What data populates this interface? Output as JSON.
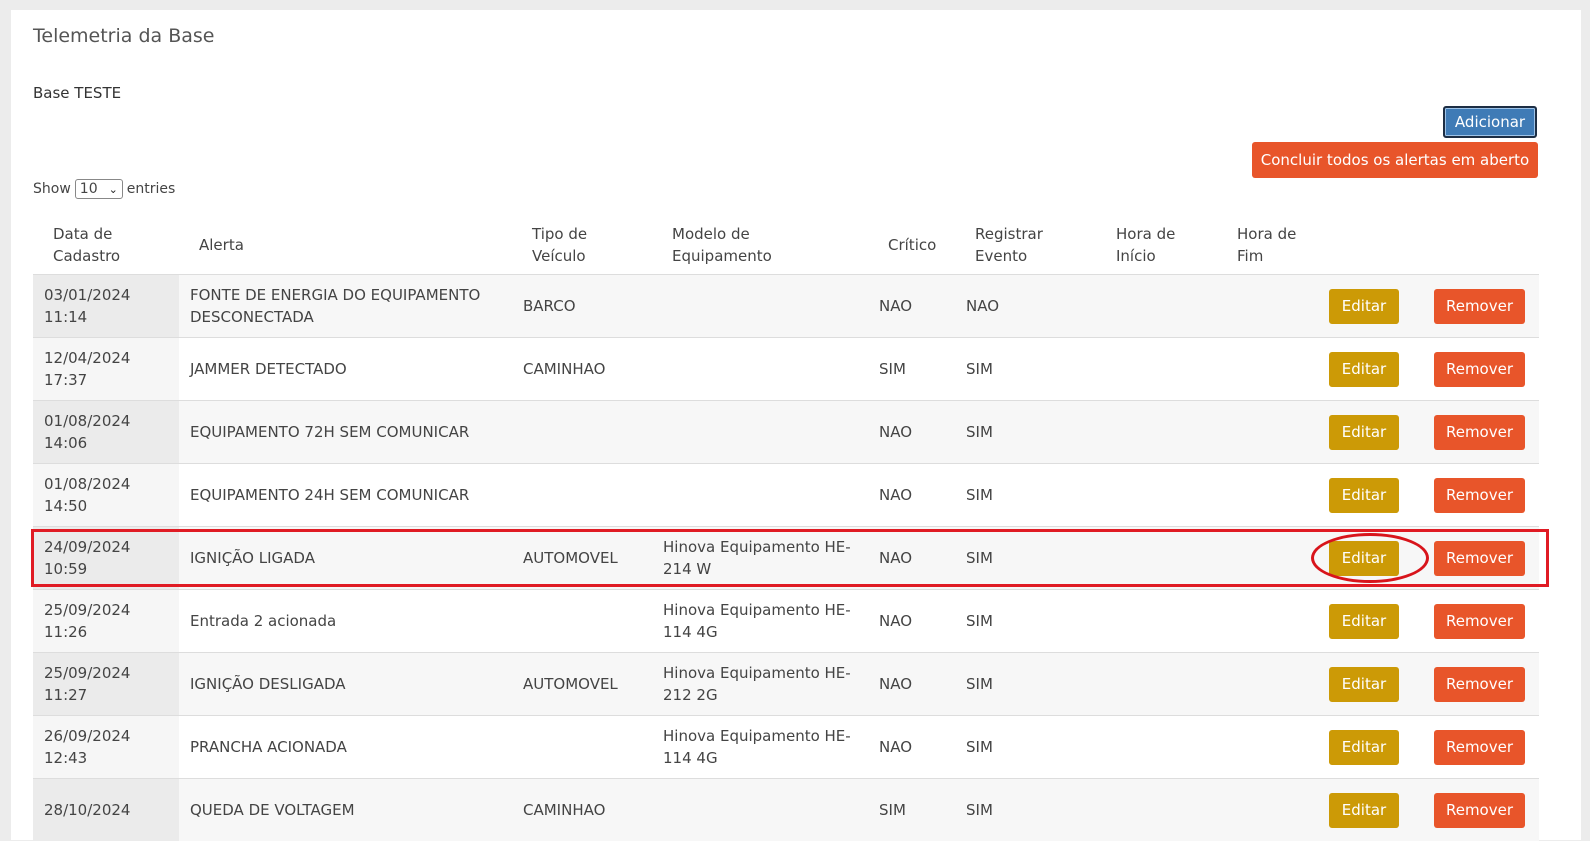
{
  "page": {
    "title": "Telemetria da Base",
    "base_name": "Base TESTE"
  },
  "actions": {
    "add_label": "Adicionar",
    "conclude_label": "Concluir todos os alertas em aberto"
  },
  "length_menu": {
    "show_label": "Show",
    "value": "10",
    "entries_label": "entries"
  },
  "table": {
    "headers": [
      "Data de Cadastro",
      "Alerta",
      "Tipo de Veículo",
      "Modelo de Equipamento",
      "Crítico",
      "Registrar Evento",
      "Hora de Início",
      "Hora de Fim"
    ],
    "edit_label": "Editar",
    "remove_label": "Remover",
    "rows": [
      {
        "date": "03/01/2024",
        "time": "11:14",
        "alerta": "FONTE DE ENERGIA DO EQUIPAMENTO DESCONECTADA",
        "tipo": "BARCO",
        "modelo": "",
        "critico": "NAO",
        "registrar": "NAO",
        "inicio": "",
        "fim": ""
      },
      {
        "date": "12/04/2024",
        "time": "17:37",
        "alerta": "JAMMER DETECTADO",
        "tipo": "CAMINHAO",
        "modelo": "",
        "critico": "SIM",
        "registrar": "SIM",
        "inicio": "",
        "fim": ""
      },
      {
        "date": "01/08/2024",
        "time": "14:06",
        "alerta": "EQUIPAMENTO 72H SEM COMUNICAR",
        "tipo": "",
        "modelo": "",
        "critico": "NAO",
        "registrar": "SIM",
        "inicio": "",
        "fim": ""
      },
      {
        "date": "01/08/2024",
        "time": "14:50",
        "alerta": "EQUIPAMENTO 24H SEM COMUNICAR",
        "tipo": "",
        "modelo": "",
        "critico": "NAO",
        "registrar": "SIM",
        "inicio": "",
        "fim": ""
      },
      {
        "date": "24/09/2024",
        "time": "10:59",
        "alerta": "IGNIÇÃO LIGADA",
        "tipo": "AUTOMOVEL",
        "modelo": "Hinova Equipamento HE-214 W",
        "critico": "NAO",
        "registrar": "SIM",
        "inicio": "",
        "fim": ""
      },
      {
        "date": "25/09/2024",
        "time": "11:26",
        "alerta": "Entrada 2 acionada",
        "tipo": "",
        "modelo": "Hinova Equipamento HE-114 4G",
        "critico": "NAO",
        "registrar": "SIM",
        "inicio": "",
        "fim": ""
      },
      {
        "date": "25/09/2024",
        "time": "11:27",
        "alerta": "IGNIÇÃO DESLIGADA",
        "tipo": "AUTOMOVEL",
        "modelo": "Hinova Equipamento HE-212 2G",
        "critico": "NAO",
        "registrar": "SIM",
        "inicio": "",
        "fim": ""
      },
      {
        "date": "26/09/2024",
        "time": "12:43",
        "alerta": "PRANCHA ACIONADA",
        "tipo": "",
        "modelo": "Hinova Equipamento HE-114 4G",
        "critico": "NAO",
        "registrar": "SIM",
        "inicio": "",
        "fim": ""
      },
      {
        "date": "28/10/2024",
        "time": "",
        "alerta": "QUEDA DE VOLTAGEM",
        "tipo": "CAMINHAO",
        "modelo": "",
        "critico": "SIM",
        "registrar": "SIM",
        "inicio": "",
        "fim": ""
      }
    ]
  },
  "annotation": {
    "highlight_row_index": 4,
    "color": "#e01b24"
  }
}
